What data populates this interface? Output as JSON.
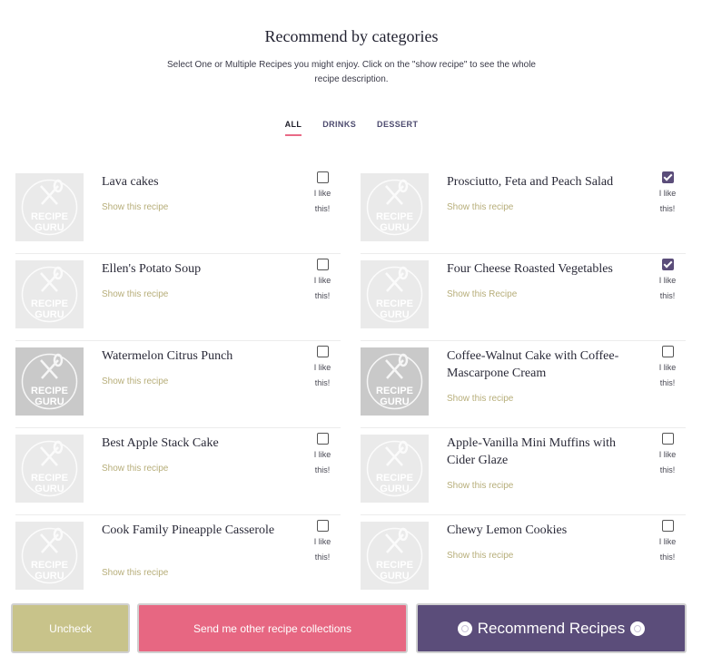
{
  "header": {
    "title": "Recommend by categories",
    "subtitle": "Select One or Multiple Recipes you might enjoy. Click on the \"show recipe\" to see the whole recipe description."
  },
  "tabs": [
    {
      "label": "ALL",
      "active": true
    },
    {
      "label": "DRINKS",
      "active": false
    },
    {
      "label": "DESSERT",
      "active": false
    }
  ],
  "thumbnail_text": {
    "line1": "RECIPE",
    "line2": "GURU"
  },
  "like_label": {
    "line1": "I like",
    "line2": "this!"
  },
  "recipes": [
    {
      "name": "Lava cakes",
      "link": "Show this recipe",
      "checked": false
    },
    {
      "name": "Prosciutto, Feta and Peach Salad",
      "link": "Show this recipe",
      "checked": true
    },
    {
      "name": "Ellen's Potato Soup",
      "link": "Show this recipe",
      "checked": false
    },
    {
      "name": "Four Cheese Roasted Vegetables",
      "link": "Show this Recipe",
      "checked": true
    },
    {
      "name": "Watermelon Citrus Punch",
      "link": "Show this recipe",
      "checked": false
    },
    {
      "name": "Coffee-Walnut Cake with Coffee-Mascarpone Cream",
      "link": "Show this recipe",
      "checked": false
    },
    {
      "name": "Best Apple Stack Cake",
      "link": "Show this recipe",
      "checked": false
    },
    {
      "name": "Apple-Vanilla Mini Muffins with Cider Glaze",
      "link": "Show this recipe",
      "checked": false
    },
    {
      "name": "Cook Family Pineapple Casserole",
      "link": "Show this recipe",
      "checked": false
    },
    {
      "name": "Chewy Lemon Cookies",
      "link": "Show this recipe",
      "checked": false
    }
  ],
  "buttons": {
    "uncheck": "Uncheck",
    "send": "Send me other recipe collections",
    "recommend": "Recommend Recipes"
  },
  "colors": {
    "accent_purple": "#5b4d7a",
    "accent_pink": "#e76782",
    "accent_olive": "#c8c38a",
    "link_color": "#b7ae7a"
  }
}
